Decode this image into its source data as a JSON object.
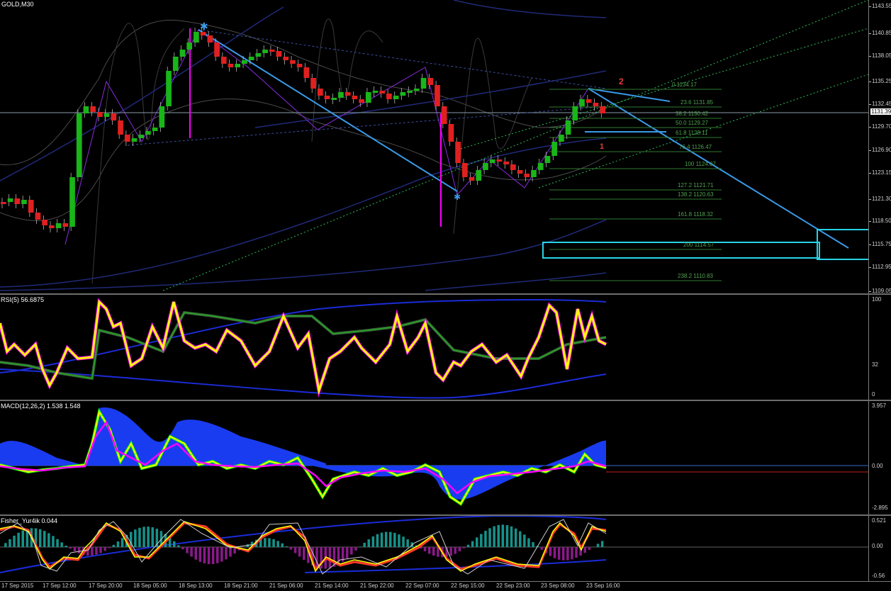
{
  "symbol_label": "GOLD,M30",
  "main_axis": {
    "ticks": [
      "1143.55",
      "1140.85",
      "1138.05",
      "1135.25",
      "1132.45",
      "1129.70",
      "1126.90",
      "1123.15",
      "1121.30",
      "1118.50",
      "1115.75",
      "1112.95",
      "1109.05"
    ],
    "current_price": "1131.39"
  },
  "fib_levels": [
    {
      "label": "0 1134.17"
    },
    {
      "label": "23.6 1131.85"
    },
    {
      "label": "38.2 1130.42"
    },
    {
      "label": "50.0 1129.27"
    },
    {
      "label": "61.8 1128.11"
    },
    {
      "label": "76.4 1126.47"
    },
    {
      "label": "100 1124.07"
    },
    {
      "label": "127.2 1121.71"
    },
    {
      "label": "138.2 1120.63"
    },
    {
      "label": "161.8 1118.32"
    },
    {
      "label": "200 1114.57"
    },
    {
      "label": "238.2 1110.83"
    }
  ],
  "wave_labels": {
    "w1": "1",
    "w2": "2"
  },
  "rsi": {
    "label": "RSI(5) 56.6875",
    "ticks": [
      "100",
      "32",
      "0"
    ]
  },
  "macd": {
    "label": "MACD(12,26,2) 1.538 1.548",
    "ticks": [
      "3.957",
      "0.00",
      "-2.895"
    ]
  },
  "fisher": {
    "label": "Fisher_Yur4ik 0.044",
    "ticks": [
      "0.521",
      "0.00",
      "-0.56"
    ]
  },
  "time_axis": [
    "17 Sep 2015",
    "17 Sep 12:00",
    "17 Sep 20:00",
    "18 Sep 05:00",
    "18 Sep 13:00",
    "18 Sep 21:00",
    "21 Sep 06:00",
    "21 Sep 14:00",
    "21 Sep 22:00",
    "22 Sep 07:00",
    "22 Sep 15:00",
    "22 Sep 23:00",
    "23 Sep 08:00",
    "23 Sep 16:00"
  ],
  "colors": {
    "trendline": "#3a9ae8",
    "box": "#27d3e6",
    "bull": "#19b519",
    "bear": "#e02020",
    "rsi": "#ffff00",
    "magenta": "#ff00ff",
    "macd_hist": "#1a3cf0"
  }
}
